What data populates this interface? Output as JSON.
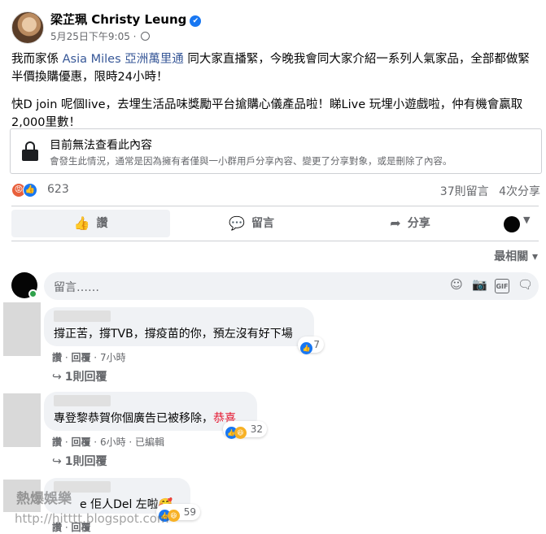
{
  "post": {
    "author": "梁芷珮 Christy Leung",
    "timestamp": "5月25日下午9:05",
    "paragraph1_pre": "我而家係 ",
    "paragraph1_link": "Asia Miles 亞洲萬里通",
    "paragraph1_post": " 同大家直播緊，今晚我會同大家介紹一系列人氣家品，全部都做緊半價換購優惠，限時24小時！",
    "paragraph2": "快D join 呢個live，去埋生活品味獎勵平台搶購心儀產品啦！睇Live 玩埋小遊戲啦，仲有機會贏取2,000里數！"
  },
  "unavailable": {
    "title": "目前無法查看此內容",
    "description": "會發生此情況，通常是因為擁有者僅與一小群用戶分享內容、變更了分享對象，或是刪除了內容。"
  },
  "stats": {
    "reaction_count": "623",
    "comments": "37則留言",
    "shares": "4次分享"
  },
  "actions": {
    "like": "讚",
    "comment": "留言",
    "share": "分享"
  },
  "sort": {
    "label": "最相關"
  },
  "composer": {
    "placeholder": "留言……"
  },
  "comments": [
    {
      "text": "撐正苦，撐TVB，撐疫苗的你，預左沒有好下場",
      "reaction_count": "7",
      "meta_like": "讚",
      "meta_reply": "回覆",
      "meta_time": "7小時",
      "replies": "1則回覆"
    },
    {
      "text": "專登黎恭賀你個廣告已被移除，",
      "text_red": "恭喜",
      "reaction_count": "32",
      "meta_like": "讚",
      "meta_reply": "回覆",
      "meta_time": "6小時",
      "meta_edited": "已編輯",
      "replies": "1則回覆"
    },
    {
      "text": "e 佢人Del 左啦🥰",
      "reaction_count": "59",
      "meta_like": "讚",
      "meta_reply": "回覆"
    }
  ],
  "watermark": {
    "line1": "熱爆娛樂",
    "line2": "http://hitttt.blogspot.com"
  },
  "colors": {
    "link": "#385898",
    "brand_blue": "#1877f2",
    "red_text": "#e4162f",
    "online": "#31a24c"
  }
}
